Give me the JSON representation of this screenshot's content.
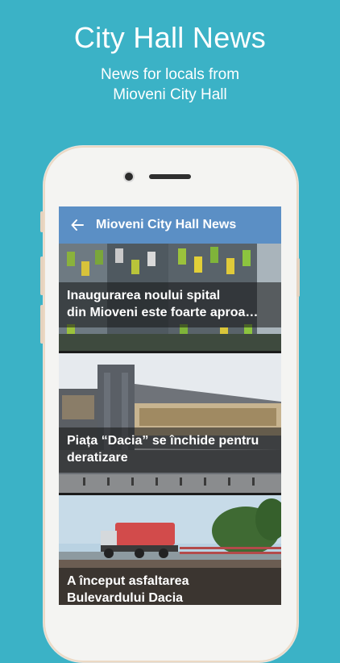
{
  "hero": {
    "title": "City Hall News",
    "subtitle_line1": "News for locals from",
    "subtitle_line2": "Mioveni City Hall"
  },
  "appbar": {
    "title": "Mioveni City Hall News",
    "back_icon": "arrow-left-icon"
  },
  "articles": [
    {
      "line1": "Inaugurarea noului spital",
      "line2": "din Mioveni este foarte aproa…"
    },
    {
      "line1": "Piața “Dacia” se închide pentru",
      "line2": "deratizare"
    },
    {
      "line1": "A început asfaltarea",
      "line2": "Bulevardului Dacia"
    }
  ],
  "colors": {
    "background": "#3bb2c6",
    "appbar": "#5b8fc5"
  }
}
